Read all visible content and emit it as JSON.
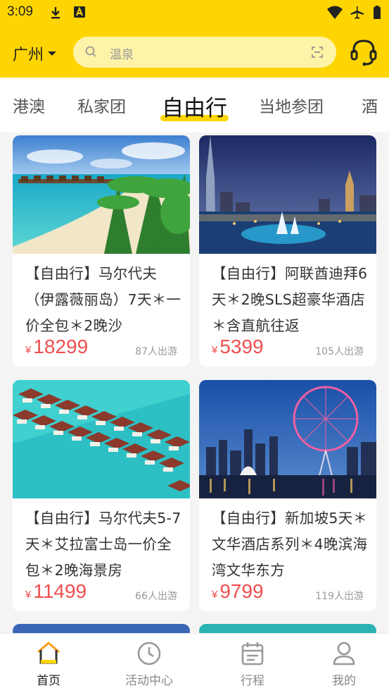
{
  "status_bar": {
    "time": "3:09"
  },
  "header": {
    "city": "广州",
    "search_placeholder": "温泉"
  },
  "tabs": [
    {
      "label": "港澳",
      "active": false
    },
    {
      "label": "私家团",
      "active": false
    },
    {
      "label": "自由行",
      "active": true
    },
    {
      "label": "当地参团",
      "active": false
    },
    {
      "label": "酒",
      "active": false
    }
  ],
  "products": [
    {
      "title": "【自由行】马尔代夫（伊露薇丽岛）7天＊一价全包＊2晚沙",
      "currency": "¥",
      "price": "18299",
      "people": "87人出游",
      "image": "maldives-beach-villas"
    },
    {
      "title": "【自由行】阿联酋迪拜6天＊2晚SLS超豪华酒店＊含直航往返",
      "currency": "¥",
      "price": "5399",
      "people": "105人出游",
      "image": "dubai-night-skyline"
    },
    {
      "title": "【自由行】马尔代夫5-7天＊艾拉富士岛一价全包＊2晚海景房",
      "currency": "¥",
      "price": "11499",
      "people": "66人出游",
      "image": "maldives-overwater-villas"
    },
    {
      "title": "【自由行】新加坡5天＊文华酒店系列＊4晚滨海湾文华东方",
      "currency": "¥",
      "price": "9799",
      "people": "119人出游",
      "image": "singapore-flyer-night"
    }
  ],
  "bottom_nav": [
    {
      "label": "首页",
      "icon": "home-icon",
      "active": true
    },
    {
      "label": "活动中心",
      "icon": "clock-icon",
      "active": false
    },
    {
      "label": "行程",
      "icon": "calendar-icon",
      "active": false
    },
    {
      "label": "我的",
      "icon": "user-icon",
      "active": false
    }
  ],
  "colors": {
    "brand_yellow": "#fed500",
    "price_red": "#ef4f4f",
    "search_bg": "#fff3a8"
  }
}
